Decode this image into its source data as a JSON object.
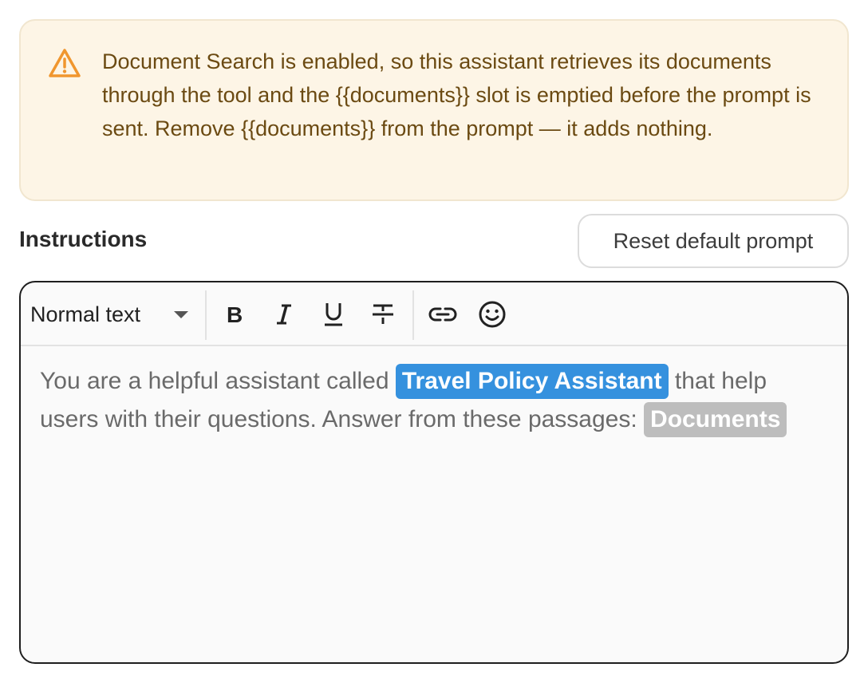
{
  "warning": {
    "icon": "warning-triangle-icon",
    "accent_color": "#f0962e",
    "message": "Document Search is enabled, so this assistant retrieves its documents through the tool and the {{documents}} slot is emptied before the prompt is sent. Remove {{documents}} from the prompt — it adds nothing."
  },
  "instructions": {
    "label": "Instructions",
    "reset_label": "Reset default prompt"
  },
  "editor": {
    "toolbar": {
      "text_style": "Normal text",
      "buttons": [
        "bold-icon",
        "italic-icon",
        "underline-icon",
        "strikethrough-icon",
        "link-icon",
        "emoji-icon"
      ]
    },
    "content": {
      "before_chip": "You are a helpful assistant called ",
      "assistant_chip": "Travel Policy Assistant",
      "after_chip": " that help users with their questions. Answer from these passages: ",
      "documents_chip": "Documents"
    },
    "chip_colors": {
      "assistant": "#3591de",
      "documents": "#bdbdbd"
    }
  }
}
